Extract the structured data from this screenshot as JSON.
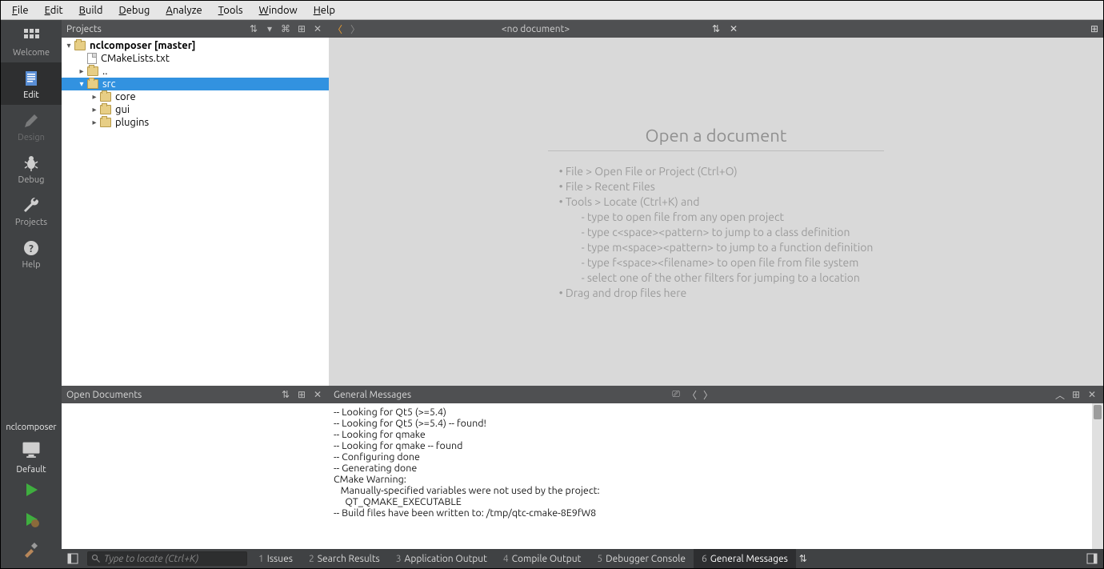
{
  "menu": {
    "items": [
      "File",
      "Edit",
      "Build",
      "Debug",
      "Analyze",
      "Tools",
      "Window",
      "Help"
    ]
  },
  "sidebar": {
    "items": [
      {
        "label": "Welcome",
        "icon": "grid"
      },
      {
        "label": "Edit",
        "icon": "doc",
        "active": true
      },
      {
        "label": "Design",
        "icon": "pencil",
        "disabled": true
      },
      {
        "label": "Debug",
        "icon": "bug"
      },
      {
        "label": "Projects",
        "icon": "wrench"
      },
      {
        "label": "Help",
        "icon": "question"
      }
    ],
    "kit": {
      "project": "nclcomposer",
      "config": "Default"
    }
  },
  "projects_pane": {
    "title": "Projects",
    "tree": {
      "root": {
        "label": "nclcomposer [master]"
      },
      "cmakelists": "CMakeLists.txt",
      "dotdot": "..",
      "src": "src",
      "children": [
        "core",
        "gui",
        "plugins"
      ]
    }
  },
  "doc_toolbar": {
    "title": "<no document>"
  },
  "placeholder": {
    "heading": "Open a document",
    "lines": [
      "File > Open File or Project (Ctrl+O)",
      "File > Recent Files",
      "Tools > Locate (Ctrl+K) and"
    ],
    "sublines": [
      "type to open file from any open project",
      "type c<space><pattern> to jump to a class definition",
      "type m<space><pattern> to jump to a function definition",
      "type f<space><filename> to open file from file system",
      "select one of the other filters for jumping to a location"
    ],
    "last": "Drag and drop files here"
  },
  "opendocs": {
    "title": "Open Documents"
  },
  "messages": {
    "title": "General Messages",
    "lines": [
      "-- Looking for Qt5 (>=5.4)",
      "-- Looking for Qt5 (>=5.4) -- found!",
      "-- Looking for qmake",
      "-- Looking for qmake -- found",
      "-- Configuring done",
      "-- Generating done",
      "CMake Warning:",
      "   Manually-specified variables were not used by the project:",
      "",
      "     QT_QMAKE_EXECUTABLE",
      "",
      "",
      "-- Build files have been written to: /tmp/qtc-cmake-8E9fW8"
    ]
  },
  "bottombar": {
    "locate_placeholder": "Type to locate (Ctrl+K)",
    "tabs": [
      {
        "n": "1",
        "label": "Issues"
      },
      {
        "n": "2",
        "label": "Search Results"
      },
      {
        "n": "3",
        "label": "Application Output"
      },
      {
        "n": "4",
        "label": "Compile Output"
      },
      {
        "n": "5",
        "label": "Debugger Console"
      },
      {
        "n": "6",
        "label": "General Messages",
        "active": true
      }
    ]
  }
}
